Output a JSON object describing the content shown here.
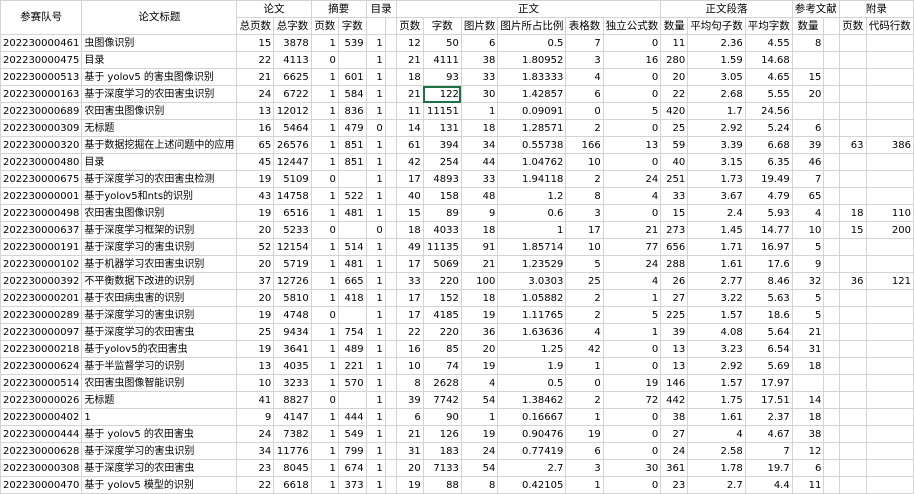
{
  "headers": {
    "top": [
      "参赛队号",
      "论文标题",
      "论文",
      "",
      "摘要",
      "",
      "目录",
      "",
      "正文",
      "",
      "",
      "",
      "",
      "",
      "正文段落",
      "",
      "",
      "参考文献",
      "",
      "附录",
      ""
    ],
    "sub": [
      "",
      "",
      "总页数",
      "总字数",
      "页数",
      "字数",
      "",
      "",
      "页数",
      "字数",
      "图片数",
      "图片所占比例",
      "表格数",
      "独立公式数",
      "数量",
      "平均句子数",
      "平均字数",
      "数量",
      "",
      "页数",
      "代码行数"
    ]
  },
  "rows": [
    [
      "202230000461",
      "虫图像识别",
      "15",
      "3878",
      "1",
      "539",
      "1",
      "",
      "12",
      "50",
      "6",
      "0.5",
      "7",
      "0",
      "11",
      "2.36",
      "4.55",
      "8",
      "",
      "",
      ""
    ],
    [
      "202230000475",
      "目录",
      "22",
      "4113",
      "0",
      "",
      "1",
      "",
      "21",
      "4111",
      "38",
      "1.80952",
      "3",
      "16",
      "280",
      "1.59",
      "14.68",
      "",
      "",
      "",
      ""
    ],
    [
      "202230000513",
      "基于 yolov5 的害虫图像识别",
      "21",
      "6625",
      "1",
      "601",
      "1",
      "",
      "18",
      "93",
      "33",
      "1.83333",
      "4",
      "0",
      "20",
      "3.05",
      "4.65",
      "15",
      "",
      "",
      ""
    ],
    [
      "202230000163",
      "基于深度学习的农田害虫识别",
      "24",
      "6722",
      "1",
      "584",
      "1",
      "",
      "21",
      "122",
      "30",
      "1.42857",
      "6",
      "0",
      "22",
      "2.68",
      "5.55",
      "20",
      "",
      "",
      ""
    ],
    [
      "202230000689",
      "农田害虫图像识别",
      "13",
      "12012",
      "1",
      "836",
      "1",
      "",
      "11",
      "11151",
      "1",
      "0.09091",
      "0",
      "5",
      "420",
      "1.7",
      "24.56",
      "",
      "",
      "",
      ""
    ],
    [
      "202230000309",
      "无标题",
      "16",
      "5464",
      "1",
      "479",
      "0",
      "",
      "14",
      "131",
      "18",
      "1.28571",
      "2",
      "0",
      "25",
      "2.92",
      "5.24",
      "6",
      "",
      "",
      ""
    ],
    [
      "202230000320",
      "基于数据挖掘在上述问题中的应用",
      "65",
      "26576",
      "1",
      "851",
      "1",
      "",
      "61",
      "394",
      "34",
      "0.55738",
      "166",
      "13",
      "59",
      "3.39",
      "6.68",
      "39",
      "",
      "63",
      "386"
    ],
    [
      "202230000480",
      "目录",
      "45",
      "12447",
      "1",
      "851",
      "1",
      "",
      "42",
      "254",
      "44",
      "1.04762",
      "10",
      "0",
      "40",
      "3.15",
      "6.35",
      "46",
      "",
      "",
      ""
    ],
    [
      "202230000675",
      "基于深度学习的农田害虫检测",
      "19",
      "5109",
      "0",
      "",
      "1",
      "",
      "17",
      "4893",
      "33",
      "1.94118",
      "2",
      "24",
      "251",
      "1.73",
      "19.49",
      "7",
      "",
      "",
      ""
    ],
    [
      "202230000001",
      "基于yolov5和nts的识别",
      "43",
      "14758",
      "1",
      "522",
      "1",
      "",
      "40",
      "158",
      "48",
      "1.2",
      "8",
      "4",
      "33",
      "3.67",
      "4.79",
      "65",
      "",
      "",
      ""
    ],
    [
      "202230000498",
      "农田害虫图像识别",
      "19",
      "6516",
      "1",
      "481",
      "1",
      "",
      "15",
      "89",
      "9",
      "0.6",
      "3",
      "0",
      "15",
      "2.4",
      "5.93",
      "4",
      "",
      "18",
      "110"
    ],
    [
      "202230000637",
      "基于深度学习框架的识别",
      "20",
      "5233",
      "0",
      "",
      "0",
      "",
      "18",
      "4033",
      "18",
      "1",
      "17",
      "21",
      "273",
      "1.45",
      "14.77",
      "10",
      "",
      "15",
      "200"
    ],
    [
      "202230000191",
      "基于深度学习的害虫识别",
      "52",
      "12154",
      "1",
      "514",
      "1",
      "",
      "49",
      "11135",
      "91",
      "1.85714",
      "10",
      "77",
      "656",
      "1.71",
      "16.97",
      "5",
      "",
      "",
      ""
    ],
    [
      "202230000102",
      "基于机器学习农田害虫识别",
      "20",
      "5719",
      "1",
      "481",
      "1",
      "",
      "17",
      "5069",
      "21",
      "1.23529",
      "5",
      "24",
      "288",
      "1.61",
      "17.6",
      "9",
      "",
      "",
      ""
    ],
    [
      "202230000392",
      "不平衡数据下改进的识别",
      "37",
      "12726",
      "1",
      "665",
      "1",
      "",
      "33",
      "220",
      "100",
      "3.0303",
      "25",
      "4",
      "26",
      "2.77",
      "8.46",
      "32",
      "",
      "36",
      "121"
    ],
    [
      "202230000201",
      "基于农田病虫害的识别",
      "20",
      "5810",
      "1",
      "418",
      "1",
      "",
      "17",
      "152",
      "18",
      "1.05882",
      "2",
      "1",
      "27",
      "3.22",
      "5.63",
      "5",
      "",
      "",
      ""
    ],
    [
      "202230000289",
      "基于深度学习的害虫识别",
      "19",
      "4748",
      "0",
      "",
      "1",
      "",
      "17",
      "4185",
      "19",
      "1.11765",
      "2",
      "5",
      "225",
      "1.57",
      "18.6",
      "5",
      "",
      "",
      ""
    ],
    [
      "202230000097",
      "基于深度学习的农田害虫",
      "25",
      "9434",
      "1",
      "754",
      "1",
      "",
      "22",
      "220",
      "36",
      "1.63636",
      "4",
      "1",
      "39",
      "4.08",
      "5.64",
      "21",
      "",
      "",
      ""
    ],
    [
      "202230000218",
      "基于yolov5的农田害虫",
      "19",
      "3641",
      "1",
      "489",
      "1",
      "",
      "16",
      "85",
      "20",
      "1.25",
      "42",
      "0",
      "13",
      "3.23",
      "6.54",
      "31",
      "",
      "",
      ""
    ],
    [
      "202230000624",
      "基于半监督学习的识别",
      "13",
      "4035",
      "1",
      "221",
      "1",
      "",
      "10",
      "74",
      "19",
      "1.9",
      "1",
      "0",
      "13",
      "2.92",
      "5.69",
      "18",
      "",
      "",
      ""
    ],
    [
      "202230000514",
      "农田害虫图像智能识别",
      "10",
      "3233",
      "1",
      "570",
      "1",
      "",
      "8",
      "2628",
      "4",
      "0.5",
      "0",
      "19",
      "146",
      "1.57",
      "17.97",
      "",
      "",
      "",
      ""
    ],
    [
      "202230000026",
      "无标题",
      "41",
      "8827",
      "0",
      "",
      "1",
      "",
      "39",
      "7742",
      "54",
      "1.38462",
      "2",
      "72",
      "442",
      "1.75",
      "17.51",
      "14",
      "",
      "",
      ""
    ],
    [
      "202230000402",
      "1",
      "9",
      "4147",
      "1",
      "444",
      "1",
      "",
      "6",
      "90",
      "1",
      "0.16667",
      "1",
      "0",
      "38",
      "1.61",
      "2.37",
      "18",
      "",
      "",
      ""
    ],
    [
      "202230000444",
      "基于 yolov5 的农田害虫",
      "24",
      "7382",
      "1",
      "549",
      "1",
      "",
      "21",
      "126",
      "19",
      "0.90476",
      "19",
      "0",
      "27",
      "4",
      "4.67",
      "38",
      "",
      "",
      ""
    ],
    [
      "202230000628",
      "基于深度学习的害虫识别",
      "34",
      "11776",
      "1",
      "799",
      "1",
      "",
      "31",
      "183",
      "24",
      "0.77419",
      "6",
      "0",
      "24",
      "2.58",
      "7",
      "12",
      "",
      "",
      ""
    ],
    [
      "202230000308",
      "基于深度学习的农田害虫",
      "23",
      "8045",
      "1",
      "674",
      "1",
      "",
      "20",
      "7133",
      "54",
      "2.7",
      "3",
      "30",
      "361",
      "1.78",
      "19.7",
      "6",
      "",
      "",
      ""
    ],
    [
      "202230000470",
      "基于 yolov5 模型的识别",
      "22",
      "6618",
      "1",
      "373",
      "1",
      "",
      "19",
      "88",
      "8",
      "0.42105",
      "1",
      "0",
      "23",
      "2.7",
      "4.4",
      "11",
      "",
      "",
      ""
    ]
  ],
  "selected_cell": {
    "row": 3,
    "col": 9
  }
}
